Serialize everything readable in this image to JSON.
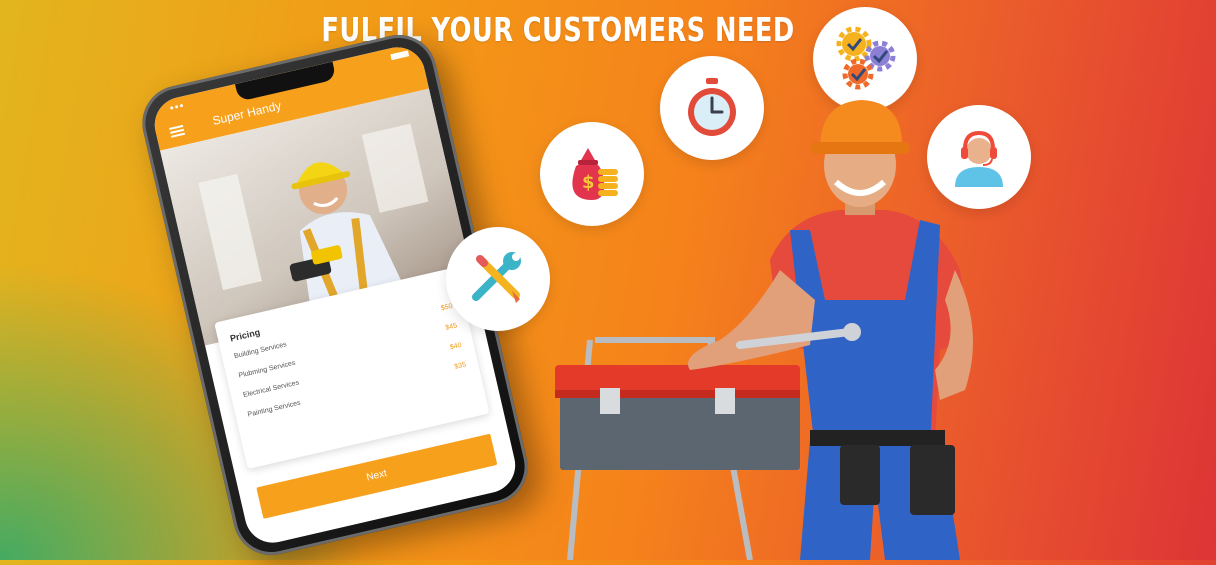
{
  "headline": "FULFIL YOUR CUSTOMERS NEED",
  "phone": {
    "app_title": "Super Handy",
    "pricing": {
      "title": "Pricing",
      "items": [
        {
          "label": "Building Services",
          "price": "$50"
        },
        {
          "label": "Plubming Services",
          "price": "$45"
        },
        {
          "label": "Electrical Services",
          "price": "$40"
        },
        {
          "label": "Painting Services",
          "price": "$35"
        }
      ]
    },
    "next_label": "Next"
  },
  "icons": [
    "tools-icon",
    "money-bag-icon",
    "stopwatch-icon",
    "gears-check-icon",
    "support-agent-icon"
  ],
  "colors": {
    "accent": "#f7a01c",
    "background_start": "#e2b51e",
    "background_end": "#dd3436",
    "helmet": "#f58a1f",
    "overalls": "#2f63c5",
    "toolbox": "#e33a2a"
  }
}
